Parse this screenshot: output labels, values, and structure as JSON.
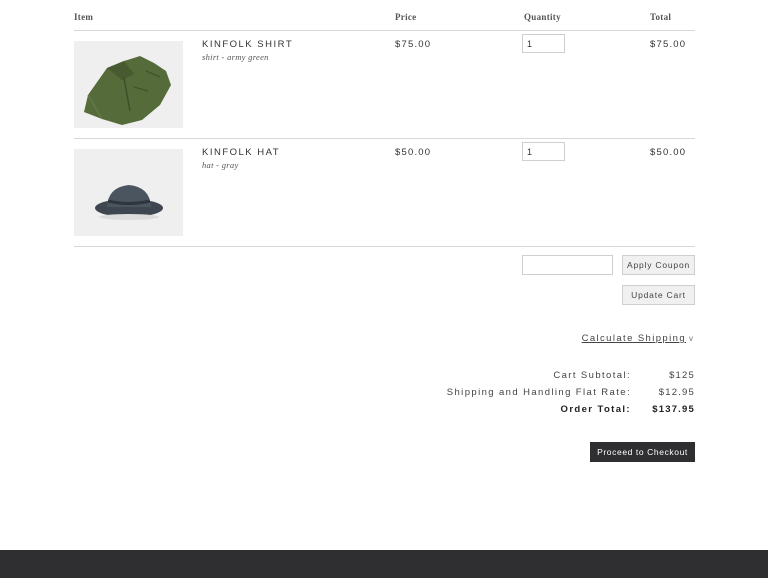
{
  "table": {
    "headers": {
      "item": "Item",
      "price": "Price",
      "quantity": "Quantity",
      "total": "Total"
    },
    "rows": [
      {
        "name": "KINFOLK SHIRT",
        "variant": "shirt - army green",
        "price": "$75.00",
        "quantity": "1",
        "total": "$75.00",
        "icon": "shirt-image"
      },
      {
        "name": "KINFOLK HAT",
        "variant": "hat - gray",
        "price": "$50.00",
        "quantity": "1",
        "total": "$50.00",
        "icon": "hat-image"
      }
    ]
  },
  "coupon": {
    "value": "",
    "apply_label": "Apply Coupon"
  },
  "update_label": "Update Cart",
  "shipping": {
    "calculate_label": "Calculate Shipping",
    "chevron": "v"
  },
  "summary": {
    "subtotal_label": "Cart Subtotal:",
    "subtotal_value": "$125",
    "shipping_label": "Shipping and Handling Flat Rate:",
    "shipping_value": "$12.95",
    "total_label": "Order Total:",
    "total_value": "$137.95"
  },
  "checkout_label": "Proceed to Checkout",
  "colors": {
    "dark": "#2f2f31",
    "border": "#d8d8d8",
    "thumb_bg": "#efefef",
    "shirt": "#556b3a",
    "hat": "#4b5560"
  }
}
